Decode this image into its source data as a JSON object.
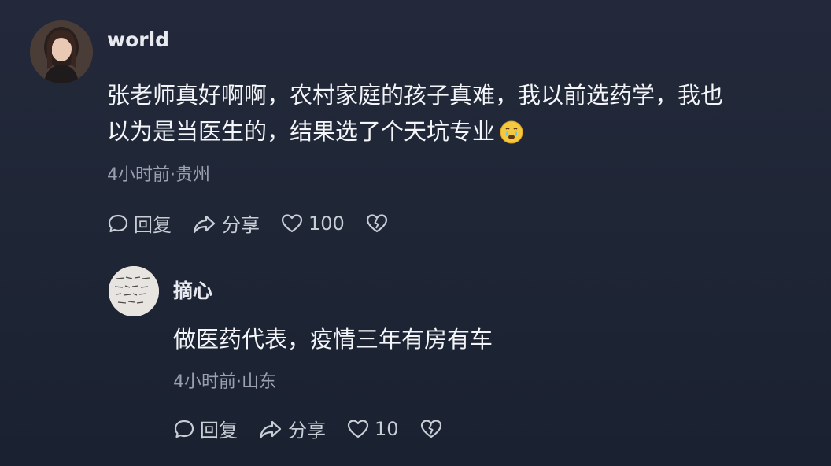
{
  "comments": [
    {
      "username": "world",
      "text_line1": "张老师真好啊啊，农村家庭的孩子真难，我以前选药学，我也",
      "text_line2": "以为是当医生的，结果选了个天坑专业",
      "emoji": "crying-face-emoji",
      "meta": "4小时前·贵州",
      "reply_label": "回复",
      "share_label": "分享",
      "like_count": "100"
    },
    {
      "username": "摘心",
      "text": "做医药代表，疫情三年有房有车",
      "meta": "4小时前·山东",
      "reply_label": "回复",
      "share_label": "分享",
      "like_count": "10"
    }
  ],
  "icons": {
    "reply": "comment-bubble-icon",
    "share": "share-arrow-icon",
    "like": "heart-icon",
    "dislike": "broken-heart-icon"
  }
}
